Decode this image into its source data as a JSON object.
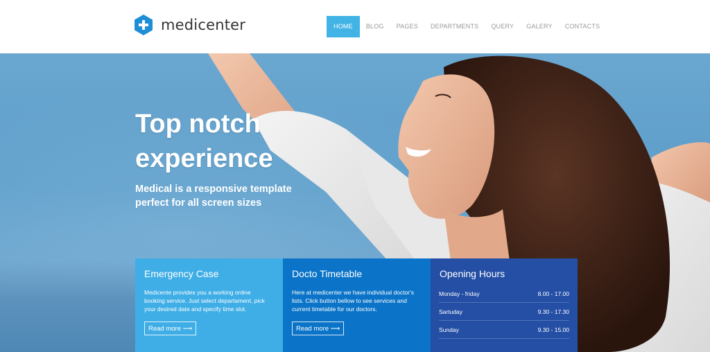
{
  "brand": {
    "name": "medicenter",
    "color": "#1e8fd6"
  },
  "nav": {
    "items": [
      {
        "label": "HOME",
        "active": true
      },
      {
        "label": "BLOG"
      },
      {
        "label": "PAGES"
      },
      {
        "label": "DEPARTMENTS"
      },
      {
        "label": "QUERY"
      },
      {
        "label": "GALERY"
      },
      {
        "label": "CONTACTS"
      }
    ]
  },
  "hero": {
    "title_line1": "Top notch",
    "title_line2": "experience",
    "subtitle_line1": "Medical is a responsive template",
    "subtitle_line2": "perfect for all screen sizes"
  },
  "panels": {
    "emergency": {
      "title": "Emergency Case",
      "text": "Medicente provides you a working online booking service. Just select departament, pick your desired date and specify time slot.",
      "button": "Read more ⟶"
    },
    "timetable": {
      "title": "Docto Timetable",
      "text": "Here at medicenter we have individual doctor's lists. Click button bellow to see services and current timetable for our doctors.",
      "button": "Read more ⟶"
    },
    "hours": {
      "title": "Opening Hours",
      "rows": [
        {
          "day": "Monday - friday",
          "time": "8.00 - 17.00"
        },
        {
          "day": "Sartuday",
          "time": "9.30 - 17.30"
        },
        {
          "day": "Sunday",
          "time": "9.30 - 15.00"
        }
      ]
    }
  },
  "colors": {
    "active_nav": "#42b3e5",
    "panel1": "#3faee6",
    "panel2": "#0b74c8",
    "panel3": "#244fa5"
  }
}
